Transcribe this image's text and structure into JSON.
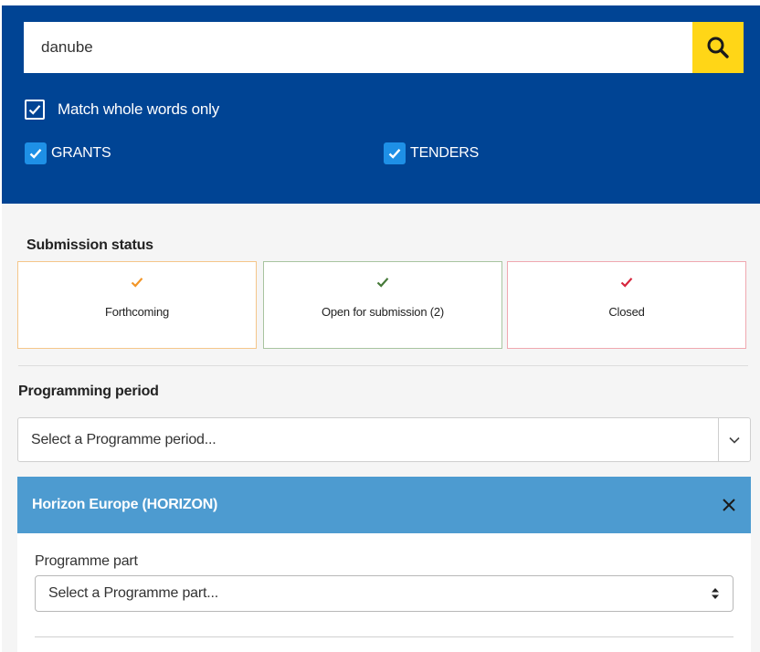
{
  "search": {
    "value": "danube",
    "placeholder": ""
  },
  "match_whole_words": {
    "label": "Match whole words only",
    "checked": true
  },
  "types": [
    {
      "label": "GRANTS",
      "checked": true
    },
    {
      "label": "TENDERS",
      "checked": true
    }
  ],
  "submission_status": {
    "title": "Submission status",
    "options": [
      {
        "label": "Forthcoming",
        "color": "#f29527"
      },
      {
        "label": "Open for submission (2)",
        "color": "#467a39"
      },
      {
        "label": "Closed",
        "color": "#d7263d"
      }
    ]
  },
  "programming_period": {
    "title": "Programming period",
    "placeholder": "Select a Programme period..."
  },
  "programme": {
    "title": "Horizon Europe (HORIZON)",
    "part_label": "Programme part",
    "part_placeholder": "Select a Programme part..."
  },
  "colors": {
    "header_bg": "#004494",
    "search_button": "#ffd617",
    "checkbox_blue": "#1e90e6",
    "programme_header": "#4d9bd0"
  },
  "icons": {
    "search_button": "search-icon",
    "checkbox": "checkmark-icon",
    "period_dropdown": "chevron-down-icon",
    "programme_close": "close-icon",
    "part_select": "sort-arrows-icon"
  }
}
